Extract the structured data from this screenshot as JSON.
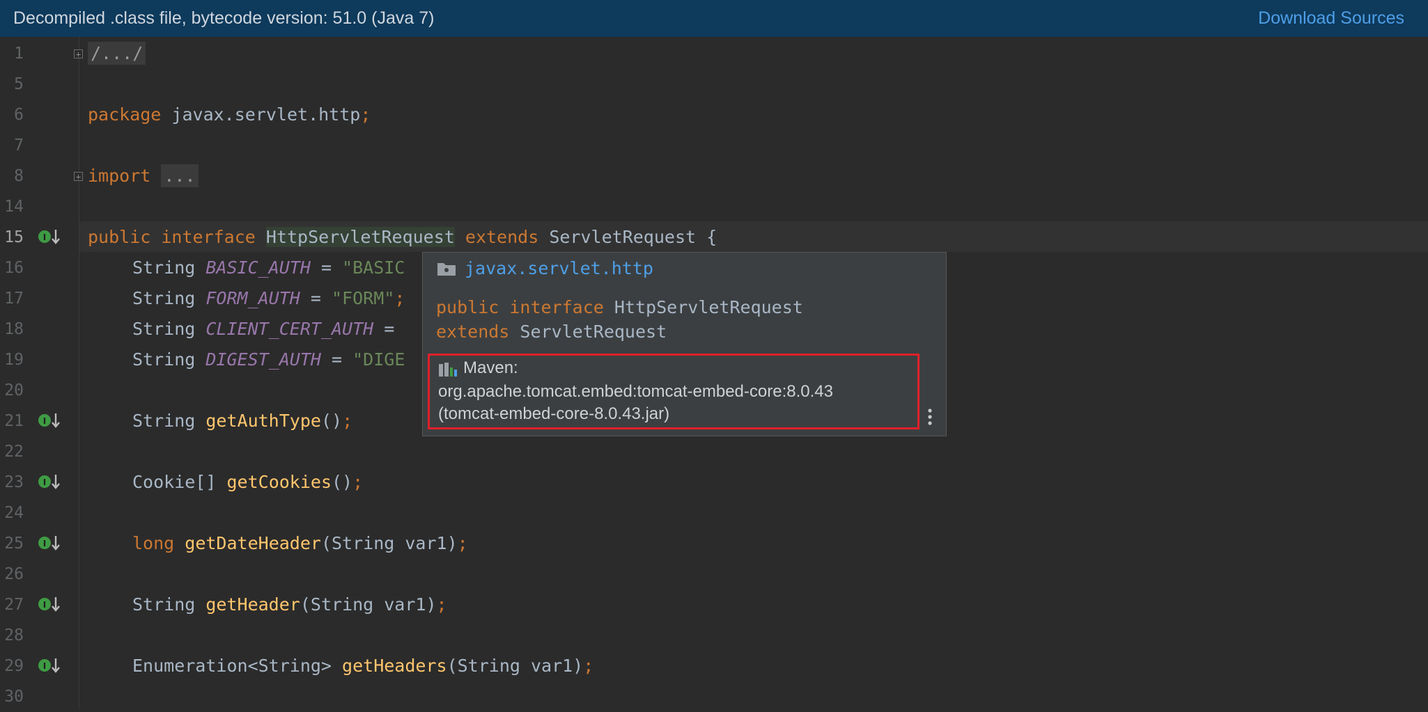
{
  "banner": {
    "message": "Decompiled .class file, bytecode version: 51.0 (Java 7)",
    "action_label": "Download Sources",
    "background": "#0e3a5c",
    "link_color": "#4e9fe8"
  },
  "gutter": {
    "line_numbers": [
      "1",
      "5",
      "6",
      "7",
      "8",
      "14",
      "15",
      "16",
      "17",
      "18",
      "19",
      "20",
      "21",
      "22",
      "23",
      "24",
      "25",
      "26",
      "27",
      "28",
      "29",
      "30"
    ],
    "current_line": "15"
  },
  "code": {
    "fold_comment": "/.../",
    "package_kw": "package",
    "package_name": " javax.servlet.http",
    "semicolon": ";",
    "import_kw": "import",
    "import_folded": "...",
    "public_kw": "public",
    "interface_kw": "interface",
    "class_name": "HttpServletRequest",
    "extends_kw": "extends",
    "super_name": "ServletRequest",
    "open_brace": " {",
    "string_type": "String",
    "basic_auth": "BASIC_AUTH",
    "basic_val": "\"BASIC",
    "form_auth": "FORM_AUTH",
    "form_val": "\"FORM\"",
    "client_cert_auth": "CLIENT_CERT_AUTH",
    "digest_auth": "DIGEST_AUTH",
    "digest_val": "\"DIGE",
    "assign": " = ",
    "get_auth_type": "getAuthType",
    "cookie_type": "Cookie[]",
    "get_cookies": "getCookies",
    "long_kw": "long",
    "get_date_header": "getDateHeader",
    "get_header": "getHeader",
    "enum_type": "Enumeration<String>",
    "get_headers": "getHeaders",
    "empty_params": "()",
    "param_string_var1": "(String var1)"
  },
  "popup": {
    "package_name": "javax.servlet.http",
    "sig_public": "public",
    "sig_interface": "interface",
    "sig_class": "HttpServletRequest",
    "sig_extends": "extends",
    "sig_super": "ServletRequest",
    "maven_label": "Maven:",
    "maven_coords": "org.apache.tomcat.embed:tomcat-embed-core:8.0.43",
    "maven_jar": "(tomcat-embed-core-8.0.43.jar)",
    "highlight_color": "#e0202a"
  },
  "icons": {
    "fold": "fold-plus-icon",
    "implemented": "implemented-method-icon",
    "package": "package-folder-icon",
    "library": "library-icon",
    "more": "more-vertical-icon"
  }
}
